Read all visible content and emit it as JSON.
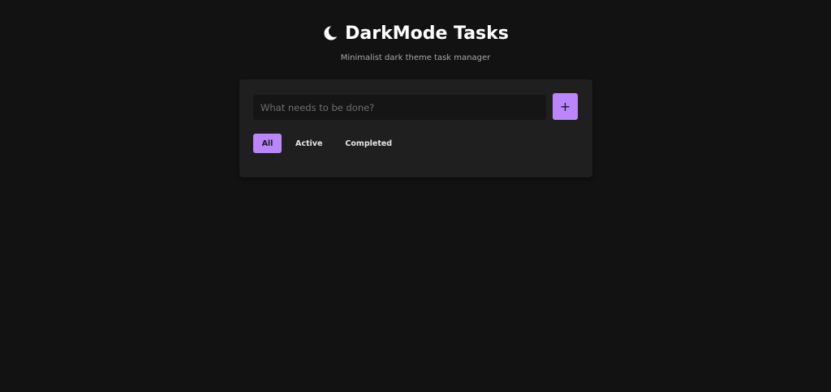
{
  "header": {
    "title": "DarkMode Tasks",
    "subtitle": "Minimalist dark theme task manager",
    "icon": "moon-icon"
  },
  "task_input": {
    "placeholder": "What needs to be done?",
    "value": ""
  },
  "add_button": {
    "label": "+"
  },
  "filters": [
    {
      "label": "All",
      "selected": true
    },
    {
      "label": "Active",
      "selected": false
    },
    {
      "label": "Completed",
      "selected": false
    }
  ],
  "colors": {
    "background": "#121212",
    "card": "#1f1f1f",
    "accent": "#bb86fc",
    "text": "#e6e6e6",
    "muted": "#a8a8a8"
  }
}
